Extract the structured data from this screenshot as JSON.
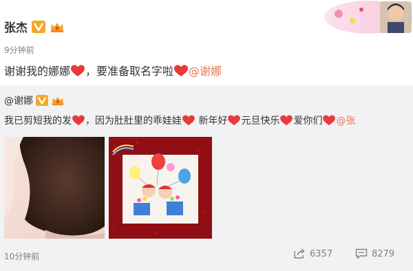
{
  "post": {
    "author": "张杰",
    "time": "9分钟前",
    "text_part1": "谢谢我的娜娜",
    "text_part2": "，要准备取名字啦",
    "mention": "@谢娜"
  },
  "repost": {
    "author": "@谢娜",
    "text": {
      "part1": "我已剪短我的发",
      "part2": "，因为肚肚里的乖娃娃",
      "part3": " 新年好",
      "part4": "元旦快乐",
      "part5": "爱你们",
      "part6": "@张"
    },
    "time": "10分钟前",
    "share_count": "6357",
    "comment_count": "8279"
  },
  "icons": {
    "verified": "orange-v-badge",
    "member": "crown-badge",
    "heart": "heart-emoji",
    "share": "share-icon",
    "comment": "comment-icon"
  },
  "colors": {
    "mention": "#eb7350",
    "heart": "#e83a3a",
    "repost_bg": "#f2f2f5",
    "meta": "#808080"
  }
}
